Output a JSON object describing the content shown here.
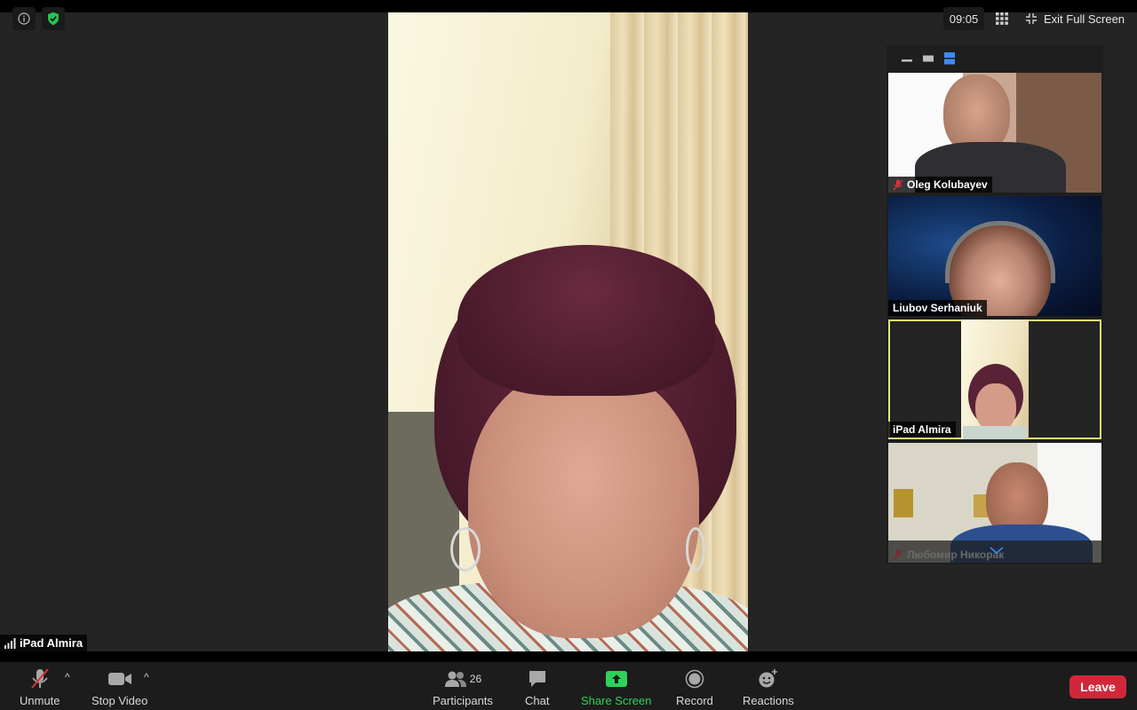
{
  "top_left": {
    "info_icon": "info-icon",
    "security_icon": "shield-check-icon",
    "security_color": "#23c552"
  },
  "top_right": {
    "clock": "09:05",
    "exit_fullscreen_label": "Exit Full Screen"
  },
  "main_video": {
    "speaker_name": "iPad Almira"
  },
  "thumbnails": [
    {
      "name": "Oleg Kolubayev",
      "muted": true,
      "active": false
    },
    {
      "name": "Liubov Serhaniuk",
      "muted": false,
      "active": false
    },
    {
      "name": "iPad Almira",
      "muted": false,
      "active": true
    },
    {
      "name": "Любомир Никорак",
      "muted": true,
      "active": false
    }
  ],
  "controls": {
    "unmute_label": "Unmute",
    "stop_video_label": "Stop Video",
    "participants_label": "Participants",
    "participants_count": "26",
    "chat_label": "Chat",
    "share_screen_label": "Share Screen",
    "record_label": "Record",
    "reactions_label": "Reactions",
    "leave_label": "Leave"
  },
  "colors": {
    "share_green": "#2ed15a",
    "leave_red": "#d0283a",
    "active_speaker_outline": "#e6e87a",
    "muted_red": "#e0303c",
    "view_mode_blue": "#3d8bfd"
  }
}
